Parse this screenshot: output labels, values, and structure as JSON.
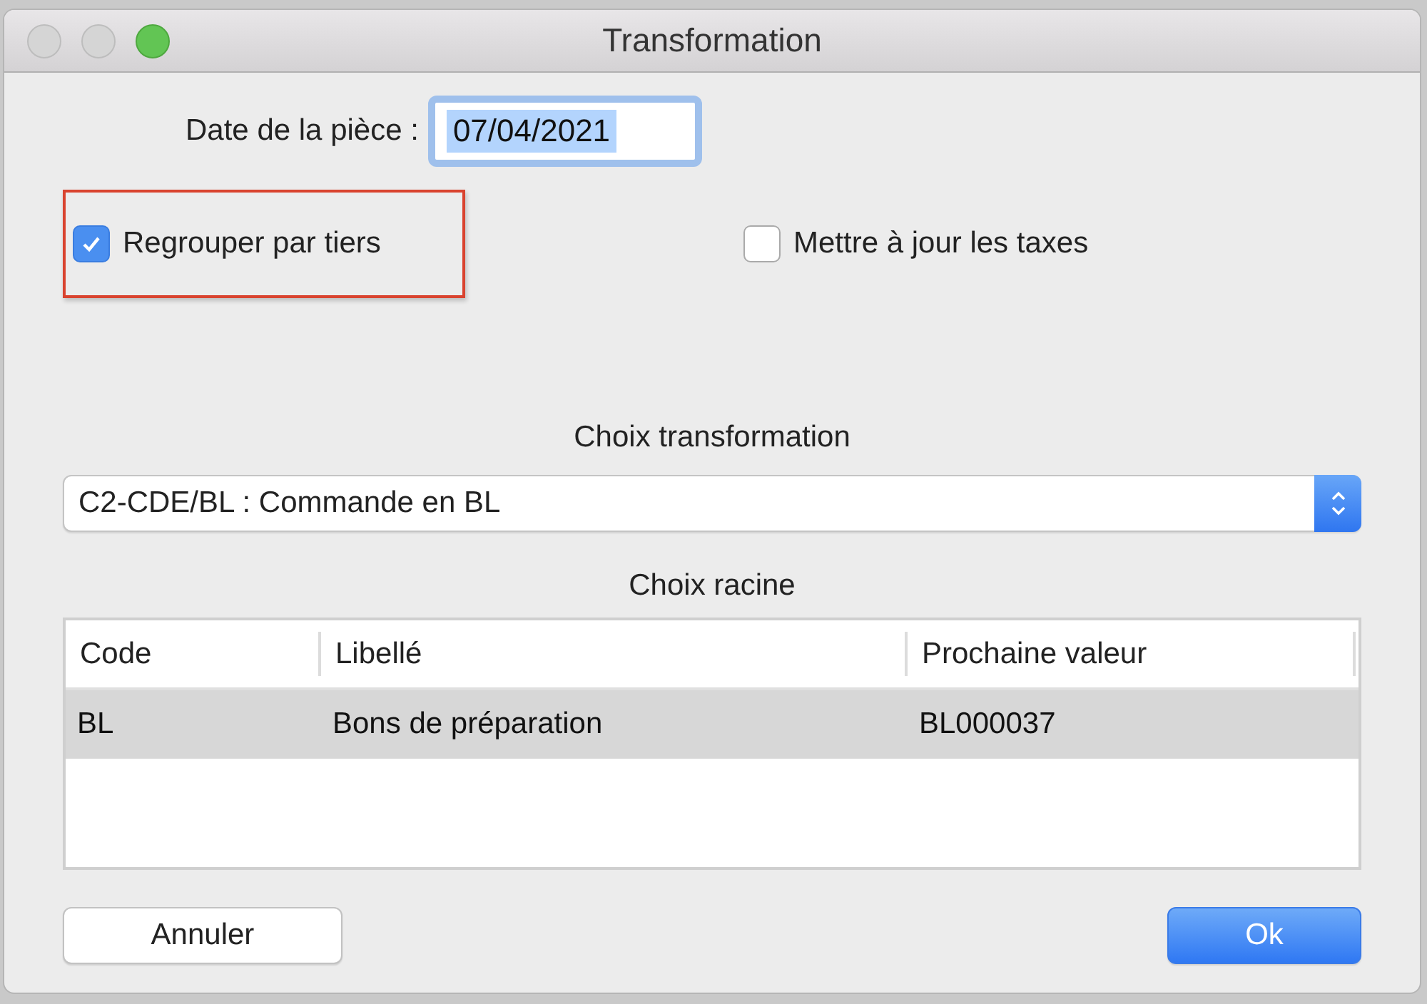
{
  "window": {
    "title": "Transformation"
  },
  "date_field": {
    "label": "Date de la pièce :",
    "value": "07/04/2021",
    "focused": true
  },
  "checkboxes": [
    {
      "label": "Regrouper par tiers",
      "checked": true,
      "highlighted": true
    },
    {
      "label": "Mettre à jour les taxes",
      "checked": false,
      "highlighted": false
    }
  ],
  "transformation": {
    "label": "Choix transformation",
    "value": "C2-CDE/BL : Commande en BL"
  },
  "root_table": {
    "label": "Choix racine",
    "columns": [
      "Code",
      "Libellé",
      "Prochaine valeur"
    ],
    "rows": [
      {
        "cells": [
          "BL",
          "Bons de préparation",
          "BL000037"
        ],
        "selected": true
      }
    ]
  },
  "buttons": [
    {
      "label": "Annuler",
      "kind": "default"
    },
    {
      "label": "Ok",
      "kind": "primary"
    }
  ]
}
